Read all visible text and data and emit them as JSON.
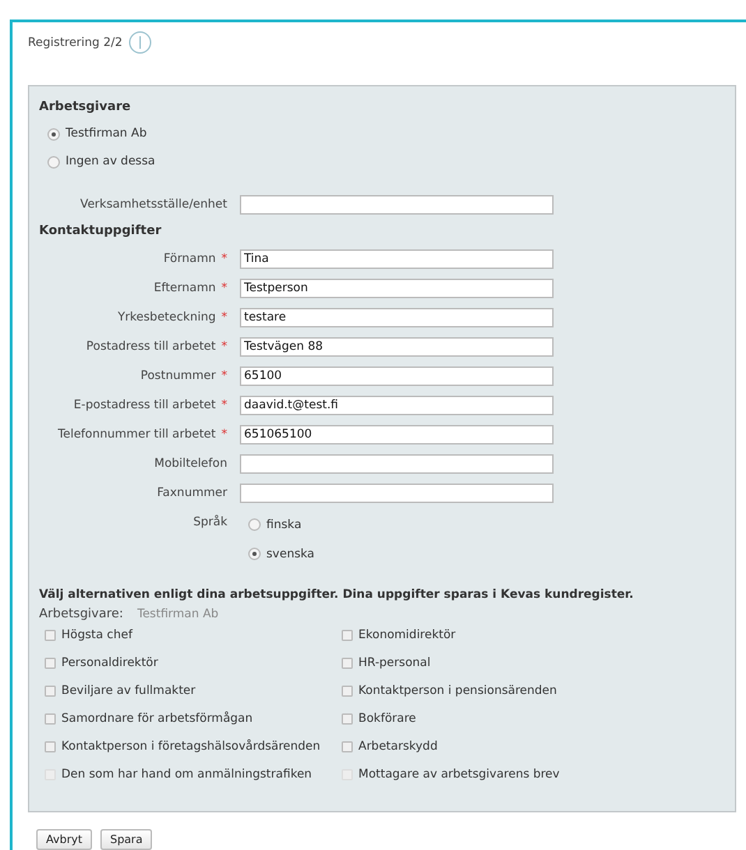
{
  "title": "Registrering 2/2",
  "employer": {
    "heading": "Arbetsgivare",
    "options": [
      {
        "label": "Testfirman Ab",
        "selected": true
      },
      {
        "label": "Ingen av dessa",
        "selected": false
      }
    ]
  },
  "unit_field": {
    "label": "Verksamhetsställe/enhet"
  },
  "contact": {
    "heading": "Kontaktuppgifter",
    "fields": [
      {
        "label": "Förnamn",
        "required": true,
        "value": "Tina"
      },
      {
        "label": "Efternamn",
        "required": true,
        "value": "Testperson"
      },
      {
        "label": "Yrkesbeteckning",
        "required": true,
        "value": "testare"
      },
      {
        "label": "Postadress till arbetet",
        "required": true,
        "value": "Testvägen 88"
      },
      {
        "label": "Postnummer",
        "required": true,
        "value": "65100"
      },
      {
        "label": "E-postadress till arbetet",
        "required": true,
        "value": "daavid.t@test.fi"
      },
      {
        "label": "Telefonnummer till arbetet",
        "required": true,
        "value": "651065100"
      },
      {
        "label": "Mobiltelefon",
        "required": false
      },
      {
        "label": "Faxnummer",
        "required": false
      }
    ],
    "required_mark": "*"
  },
  "language": {
    "label": "Språk",
    "options": [
      {
        "label": "finska",
        "selected": false
      },
      {
        "label": "svenska",
        "selected": true
      }
    ]
  },
  "roles": {
    "instruction": "Välj alternativen enligt dina arbetsuppgifter. Dina uppgifter sparas i Kevas kundregister.",
    "employer_label": "Arbetsgivare:",
    "employer_value": "Testfirman Ab",
    "options": [
      {
        "label": "Högsta chef",
        "checked": false,
        "disabled": false
      },
      {
        "label": "Ekonomidirektör",
        "checked": false,
        "disabled": false
      },
      {
        "label": "Personaldirektör",
        "checked": false,
        "disabled": false
      },
      {
        "label": "HR-personal",
        "checked": false,
        "disabled": false
      },
      {
        "label": "Beviljare av fullmakter",
        "checked": false,
        "disabled": false
      },
      {
        "label": "Kontaktperson i pensionsärenden",
        "checked": false,
        "disabled": false
      },
      {
        "label": "Samordnare för arbetsförmågan",
        "checked": false,
        "disabled": false
      },
      {
        "label": "Bokförare",
        "checked": false,
        "disabled": false
      },
      {
        "label": "Kontaktperson i företagshälsovårdsärenden",
        "checked": false,
        "disabled": false
      },
      {
        "label": "Arbetarskydd",
        "checked": false,
        "disabled": false
      },
      {
        "label": "Den som har hand om anmälningstrafiken",
        "checked": false,
        "disabled": true
      },
      {
        "label": "Mottagare av arbetsgivarens brev",
        "checked": false,
        "disabled": true
      }
    ]
  },
  "buttons": [
    "Avbryt",
    "Spara"
  ]
}
